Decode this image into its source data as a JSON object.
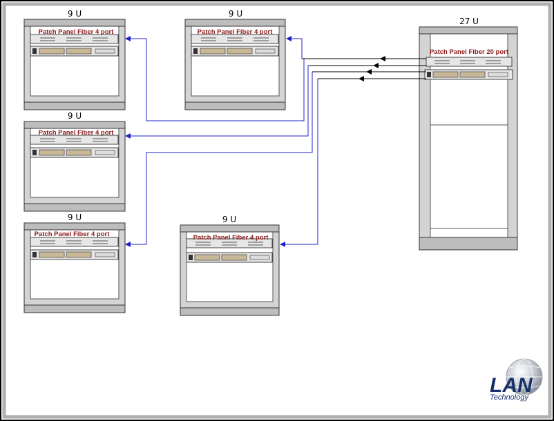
{
  "racks": [
    {
      "id": "rack-a",
      "size_label": "9 U",
      "patch_label": "Patch Panel Fiber 4 port"
    },
    {
      "id": "rack-b",
      "size_label": "9 U",
      "patch_label": "Patch Panel Fiber 4 port"
    },
    {
      "id": "rack-c",
      "size_label": "9 U",
      "patch_label": "Patch Panel Fiber 4 port"
    },
    {
      "id": "rack-d",
      "size_label": "9 U",
      "patch_label": "Patch Panel Fiber 4 port"
    },
    {
      "id": "rack-e",
      "size_label": "9 U",
      "patch_label": "Patch Panel Fiber 4 port"
    },
    {
      "id": "rack-main",
      "size_label": "27 U",
      "patch_label": "Patch Panel Fiber 20 port"
    }
  ],
  "logo": {
    "main": "LAN",
    "sub": "Technology"
  },
  "colors": {
    "link": "#2020c8",
    "arrow": "#000000",
    "label": "#8b1a1a",
    "logo": "#16306a"
  }
}
